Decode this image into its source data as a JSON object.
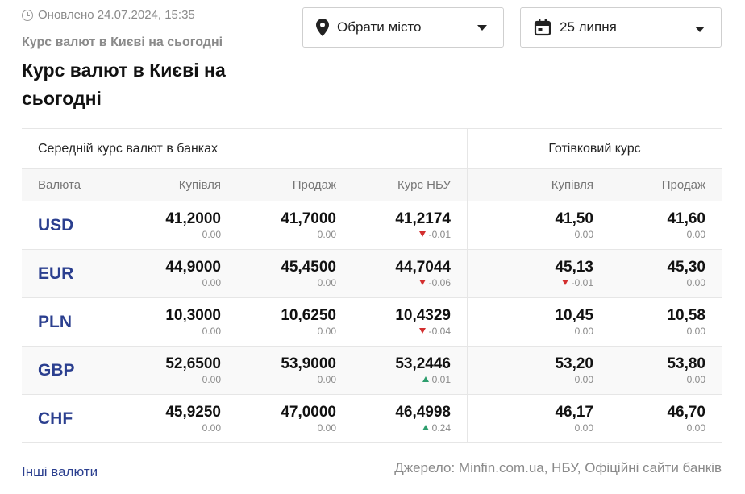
{
  "header": {
    "updated": "Оновлено 24.07.2024, 15:35",
    "subtitle": "Курс валют в Києві на сьогодні",
    "title": "Курс валют в Києві на сьогодні"
  },
  "filters": {
    "city_label": "Обрати місто",
    "date_label": "25 липня"
  },
  "table": {
    "group_left": "Середній курс валют в банках",
    "group_right": "Готівковий курс",
    "columns": [
      "Валюта",
      "Купівля",
      "Продаж",
      "Курс НБУ",
      "Купівля",
      "Продаж"
    ],
    "rows": [
      {
        "code": "USD",
        "bank_buy": {
          "value": "41,2000",
          "change": "0.00",
          "dir": ""
        },
        "bank_sell": {
          "value": "41,7000",
          "change": "0.00",
          "dir": ""
        },
        "nbu": {
          "value": "41,2174",
          "change": "-0.01",
          "dir": "down"
        },
        "cash_buy": {
          "value": "41,50",
          "change": "0.00",
          "dir": ""
        },
        "cash_sell": {
          "value": "41,60",
          "change": "0.00",
          "dir": ""
        }
      },
      {
        "code": "EUR",
        "bank_buy": {
          "value": "44,9000",
          "change": "0.00",
          "dir": ""
        },
        "bank_sell": {
          "value": "45,4500",
          "change": "0.00",
          "dir": ""
        },
        "nbu": {
          "value": "44,7044",
          "change": "-0.06",
          "dir": "down"
        },
        "cash_buy": {
          "value": "45,13",
          "change": "-0.01",
          "dir": "down"
        },
        "cash_sell": {
          "value": "45,30",
          "change": "0.00",
          "dir": ""
        }
      },
      {
        "code": "PLN",
        "bank_buy": {
          "value": "10,3000",
          "change": "0.00",
          "dir": ""
        },
        "bank_sell": {
          "value": "10,6250",
          "change": "0.00",
          "dir": ""
        },
        "nbu": {
          "value": "10,4329",
          "change": "-0.04",
          "dir": "down"
        },
        "cash_buy": {
          "value": "10,45",
          "change": "0.00",
          "dir": ""
        },
        "cash_sell": {
          "value": "10,58",
          "change": "0.00",
          "dir": ""
        }
      },
      {
        "code": "GBP",
        "bank_buy": {
          "value": "52,6500",
          "change": "0.00",
          "dir": ""
        },
        "bank_sell": {
          "value": "53,9000",
          "change": "0.00",
          "dir": ""
        },
        "nbu": {
          "value": "53,2446",
          "change": "0.01",
          "dir": "up"
        },
        "cash_buy": {
          "value": "53,20",
          "change": "0.00",
          "dir": ""
        },
        "cash_sell": {
          "value": "53,80",
          "change": "0.00",
          "dir": ""
        }
      },
      {
        "code": "CHF",
        "bank_buy": {
          "value": "45,9250",
          "change": "0.00",
          "dir": ""
        },
        "bank_sell": {
          "value": "47,0000",
          "change": "0.00",
          "dir": ""
        },
        "nbu": {
          "value": "46,4998",
          "change": "0.24",
          "dir": "up"
        },
        "cash_buy": {
          "value": "46,17",
          "change": "0.00",
          "dir": ""
        },
        "cash_sell": {
          "value": "46,70",
          "change": "0.00",
          "dir": ""
        }
      }
    ]
  },
  "footer": {
    "other_link": "Інші валюти",
    "source": "Джерело: Minfin.com.ua, НБУ, Офіційні сайти банків"
  },
  "icons": {
    "clock": "clock-icon",
    "location": "map-pin-icon",
    "calendar": "calendar-icon",
    "caret": "chevron-down-icon"
  },
  "colors": {
    "link": "#2b3f8f",
    "down": "#d32f2f",
    "up": "#2e9e6e"
  }
}
